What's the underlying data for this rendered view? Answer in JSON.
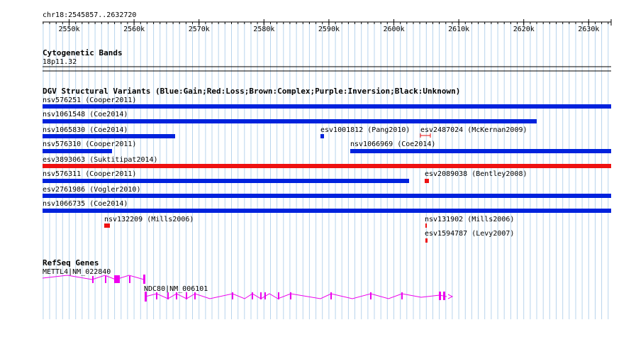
{
  "ruler": {
    "location": "chr18:2545857..2632720",
    "ticks": [
      "2550k",
      "2560k",
      "2570k",
      "2580k",
      "2590k",
      "2600k",
      "2610k",
      "2620k",
      "2630k"
    ]
  },
  "cytobands": {
    "title": "Cytogenetic Bands",
    "band": "18p11.32"
  },
  "dgv": {
    "title": "DGV Structural Variants (Blue:Gain;Red:Loss;Brown:Complex;Purple:Inversion;Black:Unknown)",
    "colors": {
      "gain": "#0022dd",
      "loss": "#ee1111"
    },
    "features": [
      {
        "label": "nsv576251 (Cooper2011)"
      },
      {
        "label": "nsv1061548 (Coe2014)"
      },
      {
        "label": "nsv1065830 (Coe2014)"
      },
      {
        "label": "esv1001812 (Pang2010)"
      },
      {
        "label": "esv2487024 (McKernan2009)"
      },
      {
        "label": "nsv576310 (Cooper2011)"
      },
      {
        "label": "nsv1066969 (Coe2014)"
      },
      {
        "label": "esv3893063 (Suktitipat2014)"
      },
      {
        "label": "nsv576311 (Cooper2011)"
      },
      {
        "label": "esv2089038 (Bentley2008)"
      },
      {
        "label": "esv2761986 (Vogler2010)"
      },
      {
        "label": "nsv1066735 (Coe2014)"
      },
      {
        "label": "nsv132209 (Mills2006)"
      },
      {
        "label": "nsv131902 (Mills2006)"
      },
      {
        "label": "esv1594787 (Levy2007)"
      }
    ]
  },
  "refseq": {
    "title": "RefSeq Genes",
    "color": "#ee00ee",
    "genes": [
      {
        "label": "METTL4|NM_022840"
      },
      {
        "label": "NDC80|NM_006101"
      }
    ]
  }
}
